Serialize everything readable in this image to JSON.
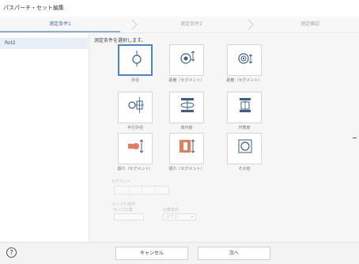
{
  "window": {
    "title": "パスパーチ・セット編集"
  },
  "steps": [
    {
      "label": "測定条件1"
    },
    {
      "label": "測定条件2"
    },
    {
      "label": "測定確認"
    }
  ],
  "sidebar": {
    "items": [
      {
        "label": "Rot2"
      }
    ]
  },
  "main": {
    "instruction": "測定条件を選択します。",
    "tiles": [
      {
        "label": "外径",
        "icon": "outer-diameter-icon",
        "selected": true
      },
      {
        "label": "距離（セグメント）",
        "icon": "distance-segment-icon",
        "selected": false
      },
      {
        "label": "距離（セグメント）",
        "icon": "distance-segment-alt-icon",
        "selected": false
      },
      {
        "label": "平行外径",
        "icon": "parallel-outer-diameter-icon",
        "selected": false
      },
      {
        "label": "真円度",
        "icon": "roundness-icon",
        "selected": false
      },
      {
        "label": "円筒度",
        "icon": "cylindricity-icon",
        "selected": false
      },
      {
        "label": "振れ（セグメント）",
        "icon": "runout-segment-icon",
        "selected": false
      },
      {
        "label": "振れ（セグメント）",
        "icon": "runout-segment-alt-icon",
        "selected": false
      },
      {
        "label": "その他",
        "icon": "other-icon",
        "selected": false
      }
    ],
    "segment_label": "セグメント",
    "sample_label": "サンプル操作",
    "sample_sub_label": "サンプル数",
    "sample_dropdown_value": "",
    "filter_label": "計算条件",
    "filter_dropdown_value": "ガウシ"
  },
  "footer": {
    "help": "?",
    "cancel_label": "キャンセル",
    "next_label": "次へ"
  },
  "colors": {
    "accent": "#4a86c5",
    "tile_icon": "#3d5f86",
    "orange": "#e97a5a"
  }
}
